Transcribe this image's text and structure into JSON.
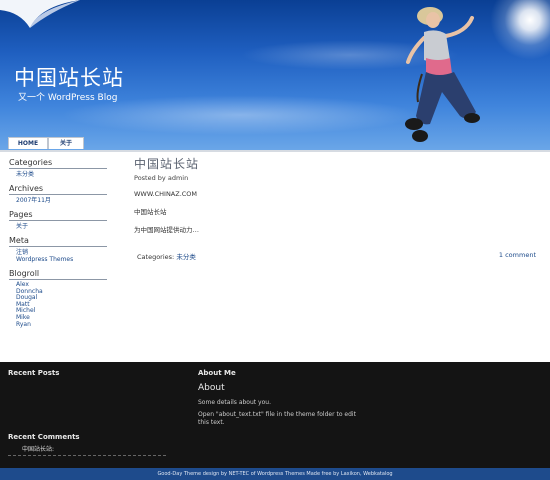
{
  "header": {
    "site_title": "中国站长站",
    "tagline": "又一个 WordPress Blog"
  },
  "nav": {
    "tabs": [
      {
        "label": "HOME"
      },
      {
        "label": "关于"
      }
    ]
  },
  "sidebar": {
    "categories": {
      "heading": "Categories",
      "items": [
        "未分类"
      ]
    },
    "archives": {
      "heading": "Archives",
      "items": [
        "2007年11月"
      ]
    },
    "pages": {
      "heading": "Pages",
      "items": [
        "关于"
      ]
    },
    "meta": {
      "heading": "Meta",
      "items": [
        "注销",
        "Wordpress Themes"
      ]
    },
    "blogroll": {
      "heading": "Blogroll",
      "items": [
        "Alex",
        "Donncha",
        "Dougal",
        "Matt",
        "Michel",
        "Mike",
        "Ryan"
      ]
    }
  },
  "post": {
    "title": "中国站长站",
    "meta": "Posted by admin",
    "paragraphs": [
      "WWW.CHINAZ.COM",
      "中国站长站",
      "为中国网站提供动力…"
    ],
    "categories_label": "Categories:",
    "category": "未分类",
    "comments": "1 comment"
  },
  "footer": {
    "recent_posts_heading": "Recent Posts",
    "recent_comments_heading": "Recent Comments",
    "recent_comment_item": "中国站长站:",
    "about_me_heading": "About Me",
    "about_title": "About",
    "about_p1": "Some details about you.",
    "about_p2": "Open \"about_text.txt\" file in the theme folder to edit this text."
  },
  "credits": "Good-Day Theme design by NET-TEC of Wordpress Themes Made free by Laxikon, Webkatalog",
  "colors": {
    "link": "#1c4a8a",
    "footer_bg": "#141414",
    "credit_bar": "#1e4b8c"
  }
}
